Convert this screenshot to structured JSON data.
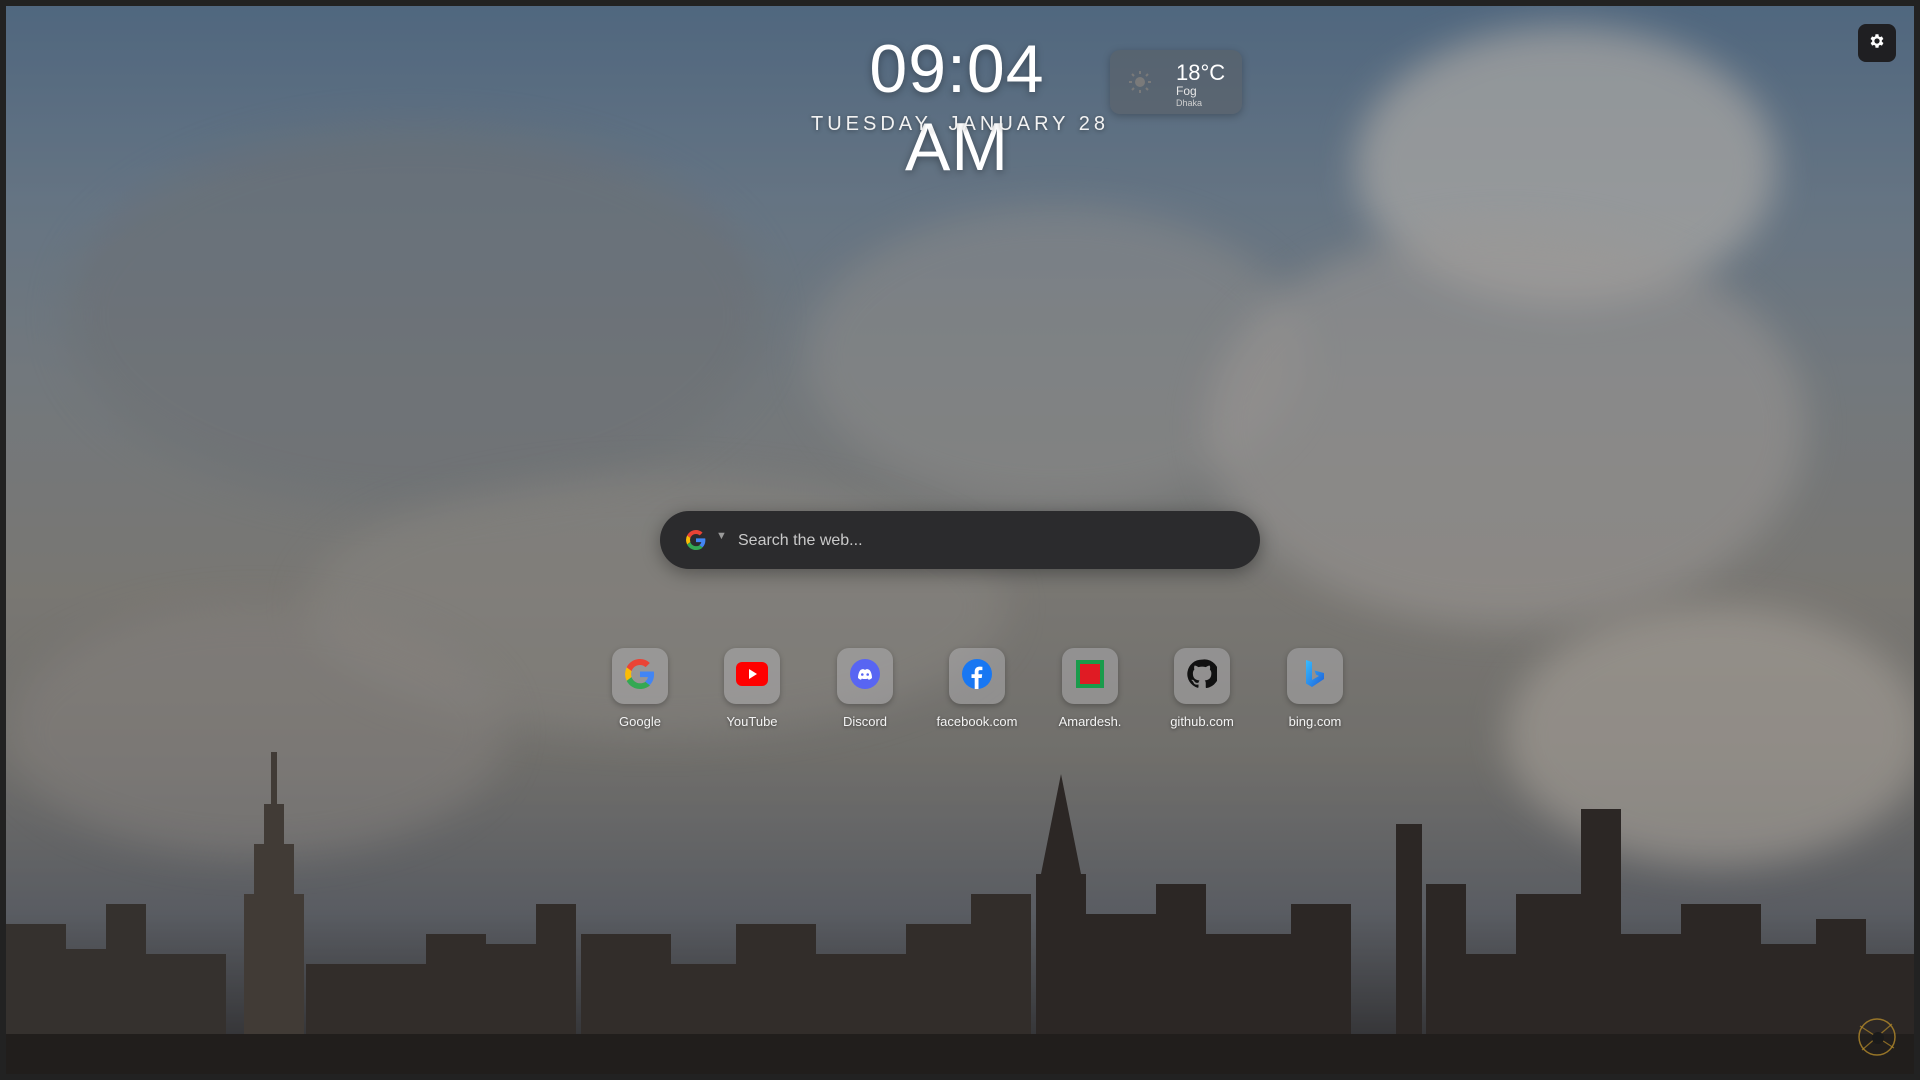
{
  "clock": {
    "time": "09:04 AM",
    "date": "TUESDAY, JANUARY 28"
  },
  "weather": {
    "temperature": "18°C",
    "condition": "Fog",
    "city": "Dhaka",
    "icon": "sun-icon"
  },
  "settings": {
    "icon": "gear-icon"
  },
  "search": {
    "engine_icon": "google-icon",
    "placeholder": "Search the web..."
  },
  "shortcuts": [
    {
      "label": "Google",
      "icon": "google-icon"
    },
    {
      "label": "YouTube",
      "icon": "youtube-icon"
    },
    {
      "label": "Discord",
      "icon": "discord-icon"
    },
    {
      "label": "facebook.com",
      "icon": "facebook-icon"
    },
    {
      "label": "Amardesh.",
      "icon": "amardesh-icon"
    },
    {
      "label": "github.com",
      "icon": "github-icon"
    },
    {
      "label": "bing.com",
      "icon": "bing-icon"
    }
  ],
  "colors": {
    "search_bg": "#2b2b2d",
    "settings_bg": "#1f1f22",
    "youtube": "#ff0000",
    "facebook": "#1877f2",
    "discord": "#5865f2",
    "amardesh": "#e01b24",
    "bing": "#1f9be5"
  }
}
